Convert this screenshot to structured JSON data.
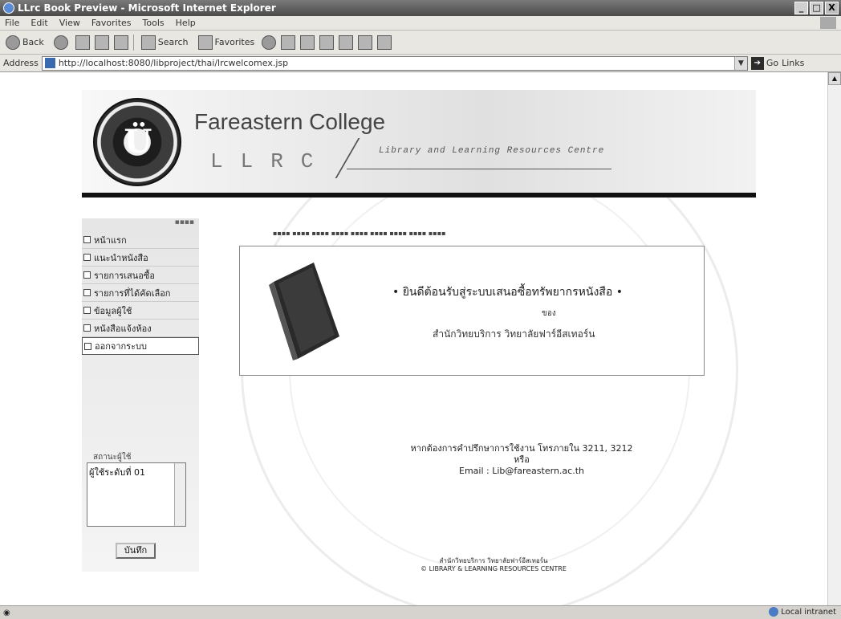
{
  "window": {
    "title": "LLrc Book Preview - Microsoft Internet Explorer",
    "buttons": [
      "_",
      "□",
      "X"
    ]
  },
  "menubar": [
    "File",
    "Edit",
    "View",
    "Favorites",
    "Tools",
    "Help"
  ],
  "toolbar": {
    "back": "Back",
    "search": "Search",
    "favorites": "Favorites"
  },
  "address": {
    "label": "Address",
    "url": "http://localhost:8080/libproject/thai/lrcwelcomex.jsp",
    "go": "Go",
    "links": "Links"
  },
  "header": {
    "college": "Fareastern College",
    "llrc": "LLRC",
    "subtitle": "Library and Learning Resources Centre"
  },
  "sidebar": {
    "items": [
      {
        "label": "หน้าแรก"
      },
      {
        "label": "แนะนำหนังสือ"
      },
      {
        "label": "รายการเสนอซื้อ"
      },
      {
        "label": "รายการที่ได้คัดเลือก"
      },
      {
        "label": "ข้อมูลผู้ใช้"
      },
      {
        "label": "หนังสือแจ้งห้อง"
      },
      {
        "label": "ออกจากระบบ"
      }
    ],
    "status_label": "สถานะผู้ใช้",
    "status_value": "ผู้ใช้ระดับที่ 01",
    "save_label": "บันทึก"
  },
  "main": {
    "welcome_title": "• ยินดีต้อนรับสู่ระบบเสนอซื้อทรัพยากรหนังสือ •",
    "welcome_of": "ของ",
    "welcome_org": "สำนักวิทยบริการ วิทยาลัยฟาร์อีสเทอร์น",
    "contact_line1": "หากต้องการคำปรึกษาการใช้งาน โทรภายใน 3211, 3212",
    "contact_line2": "หรือ",
    "contact_line3": "Email : Lib@fareastern.ac.th",
    "footer_line1": "สำนักวิทยบริการ วิทยาลัยฟาร์อีสเทอร์น",
    "footer_line2": "© LIBRARY & LEARNING RESOURCES CENTRE"
  },
  "statusbar": {
    "zone": "Local intranet"
  }
}
